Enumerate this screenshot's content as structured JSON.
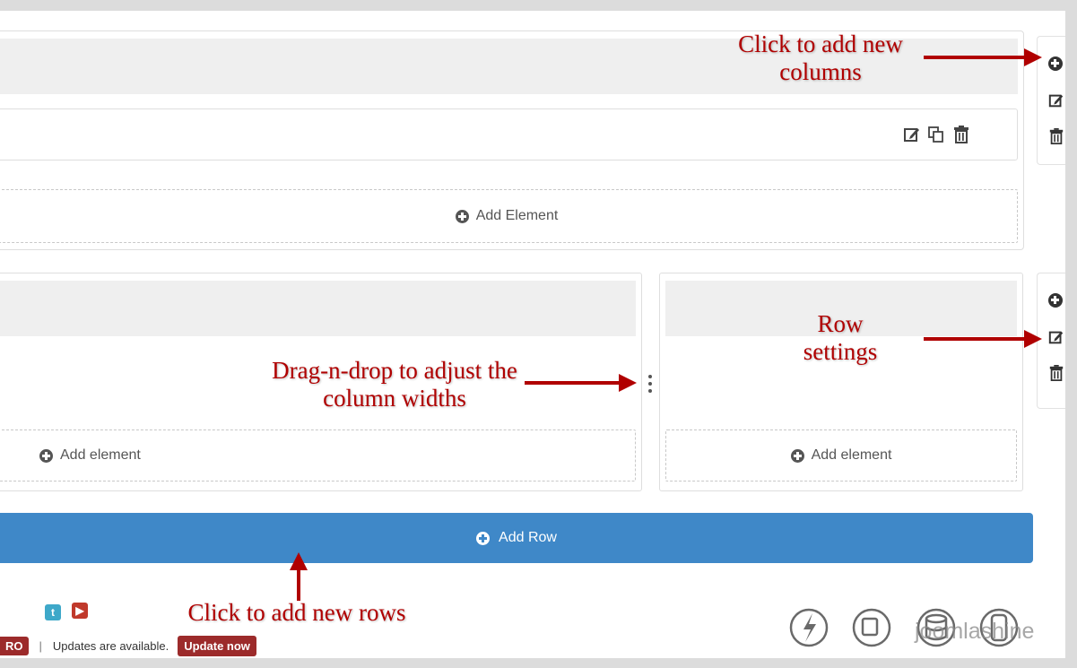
{
  "builder": {
    "row1": {
      "add_element_label": "Add Element"
    },
    "row2": {
      "col1_add_element_label": "Add element",
      "col2_add_element_label": "Add element"
    },
    "add_row_label": "Add Row"
  },
  "annotations": {
    "add_columns": "Click to add new columns",
    "row_settings": "Row settings",
    "drag_drop": "Drag-n-drop to adjust the column widths",
    "add_rows": "Click to add new rows"
  },
  "footer": {
    "pro_badge": "RO",
    "separator": "|",
    "updates_text": "Updates are available.",
    "update_button": "Update now",
    "brand": "joomlashine"
  },
  "colors": {
    "accent_blue": "#3f88c8",
    "annotation_red": "#b00000",
    "badge_red": "#9c2b2b"
  }
}
